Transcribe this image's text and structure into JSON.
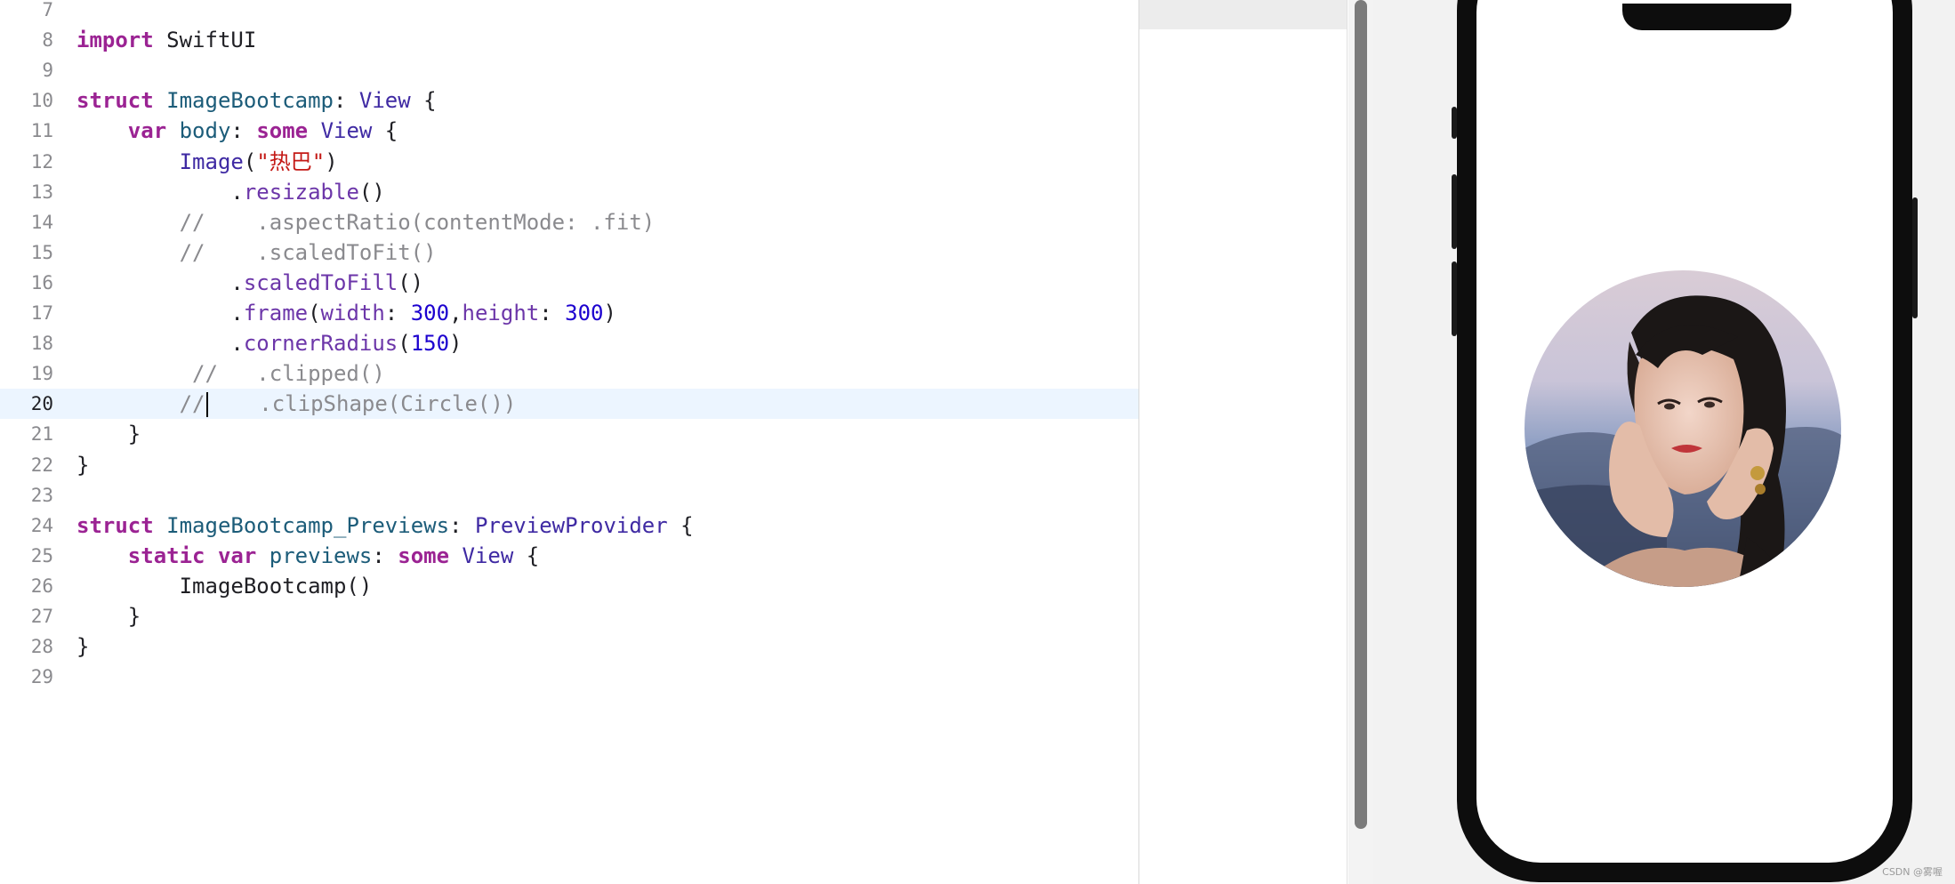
{
  "editor": {
    "lines": [
      {
        "n": "7",
        "tokens": []
      },
      {
        "n": "8",
        "tokens": [
          {
            "t": "import",
            "c": "kw"
          },
          {
            "t": " SwiftUI",
            "c": ""
          }
        ]
      },
      {
        "n": "9",
        "tokens": []
      },
      {
        "n": "10",
        "tokens": [
          {
            "t": "struct",
            "c": "kw"
          },
          {
            "t": " ",
            "c": ""
          },
          {
            "t": "ImageBootcamp",
            "c": "tu"
          },
          {
            "t": ": ",
            "c": ""
          },
          {
            "t": "View",
            "c": "ty"
          },
          {
            "t": " {",
            "c": ""
          }
        ]
      },
      {
        "n": "11",
        "tokens": [
          {
            "t": "    ",
            "c": ""
          },
          {
            "t": "var",
            "c": "kw"
          },
          {
            "t": " ",
            "c": ""
          },
          {
            "t": "body",
            "c": "tu"
          },
          {
            "t": ": ",
            "c": ""
          },
          {
            "t": "some",
            "c": "kw"
          },
          {
            "t": " ",
            "c": ""
          },
          {
            "t": "View",
            "c": "ty"
          },
          {
            "t": " {",
            "c": ""
          }
        ]
      },
      {
        "n": "12",
        "tokens": [
          {
            "t": "        ",
            "c": ""
          },
          {
            "t": "Image",
            "c": "ty"
          },
          {
            "t": "(",
            "c": ""
          },
          {
            "t": "\"热巴\"",
            "c": "str"
          },
          {
            "t": ")",
            "c": ""
          }
        ]
      },
      {
        "n": "13",
        "tokens": [
          {
            "t": "            .",
            "c": ""
          },
          {
            "t": "resizable",
            "c": "fn"
          },
          {
            "t": "()",
            "c": ""
          }
        ]
      },
      {
        "n": "14",
        "tokens": [
          {
            "t": "        //    .aspectRatio(contentMode: .fit)",
            "c": "cm"
          }
        ]
      },
      {
        "n": "15",
        "tokens": [
          {
            "t": "        //    .scaledToFit()",
            "c": "cm"
          }
        ]
      },
      {
        "n": "16",
        "tokens": [
          {
            "t": "            .",
            "c": ""
          },
          {
            "t": "scaledToFill",
            "c": "fn"
          },
          {
            "t": "()",
            "c": ""
          }
        ]
      },
      {
        "n": "17",
        "tokens": [
          {
            "t": "            .",
            "c": ""
          },
          {
            "t": "frame",
            "c": "fn"
          },
          {
            "t": "(",
            "c": ""
          },
          {
            "t": "width",
            "c": "fn"
          },
          {
            "t": ": ",
            "c": ""
          },
          {
            "t": "300",
            "c": "num"
          },
          {
            "t": ",",
            "c": ""
          },
          {
            "t": "height",
            "c": "fn"
          },
          {
            "t": ": ",
            "c": ""
          },
          {
            "t": "300",
            "c": "num"
          },
          {
            "t": ")",
            "c": ""
          }
        ]
      },
      {
        "n": "18",
        "tokens": [
          {
            "t": "            .",
            "c": ""
          },
          {
            "t": "cornerRadius",
            "c": "fn"
          },
          {
            "t": "(",
            "c": ""
          },
          {
            "t": "150",
            "c": "num"
          },
          {
            "t": ")",
            "c": ""
          }
        ]
      },
      {
        "n": "19",
        "tokens": [
          {
            "t": "         //   .clipped()",
            "c": "cm"
          }
        ]
      },
      {
        "n": "20",
        "current": true,
        "tokens": [
          {
            "t": "        //",
            "c": "cm"
          },
          {
            "t": "|",
            "c": "caret"
          },
          {
            "t": "    .clipShape(Circle())",
            "c": "cm"
          }
        ]
      },
      {
        "n": "21",
        "tokens": [
          {
            "t": "    }",
            "c": ""
          }
        ]
      },
      {
        "n": "22",
        "tokens": [
          {
            "t": "}",
            "c": ""
          }
        ]
      },
      {
        "n": "23",
        "tokens": []
      },
      {
        "n": "24",
        "tokens": [
          {
            "t": "struct",
            "c": "kw"
          },
          {
            "t": " ",
            "c": ""
          },
          {
            "t": "ImageBootcamp_Previews",
            "c": "tu"
          },
          {
            "t": ": ",
            "c": ""
          },
          {
            "t": "PreviewProvider",
            "c": "ty"
          },
          {
            "t": " {",
            "c": ""
          }
        ]
      },
      {
        "n": "25",
        "tokens": [
          {
            "t": "    ",
            "c": ""
          },
          {
            "t": "static",
            "c": "kw"
          },
          {
            "t": " ",
            "c": ""
          },
          {
            "t": "var",
            "c": "kw"
          },
          {
            "t": " ",
            "c": ""
          },
          {
            "t": "previews",
            "c": "tu"
          },
          {
            "t": ": ",
            "c": ""
          },
          {
            "t": "some",
            "c": "kw"
          },
          {
            "t": " ",
            "c": ""
          },
          {
            "t": "View",
            "c": "ty"
          },
          {
            "t": " {",
            "c": ""
          }
        ]
      },
      {
        "n": "26",
        "tokens": [
          {
            "t": "        ImageBootcamp()",
            "c": ""
          }
        ]
      },
      {
        "n": "27",
        "tokens": [
          {
            "t": "    }",
            "c": ""
          }
        ]
      },
      {
        "n": "28",
        "tokens": [
          {
            "t": "}",
            "c": ""
          }
        ]
      },
      {
        "n": "29",
        "tokens": []
      }
    ]
  },
  "preview": {
    "image_icon": "portrait-photo",
    "watermark": "CSDN @雾喔"
  },
  "colors": {
    "keyword": "#9b2393",
    "type": "#3f2aa3",
    "user_type": "#1c5c79",
    "function": "#6c36a9",
    "number": "#1c00cf",
    "string": "#c41a16",
    "comment": "#8a8a8e",
    "current_line_bg": "#ecf5ff"
  }
}
